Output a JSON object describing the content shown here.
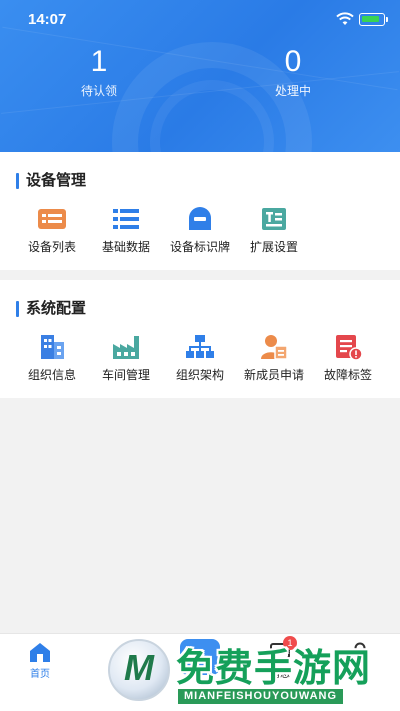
{
  "status_bar": {
    "time": "14:07"
  },
  "stats": [
    {
      "value": "1",
      "label": "待认领"
    },
    {
      "value": "0",
      "label": "处理中"
    }
  ],
  "sections": [
    {
      "title": "设备管理",
      "items": [
        {
          "label": "设备列表",
          "icon": "device-list-icon"
        },
        {
          "label": "基础数据",
          "icon": "list-icon"
        },
        {
          "label": "设备标识牌",
          "icon": "device-tag-icon"
        },
        {
          "label": "扩展设置",
          "icon": "extend-settings-icon"
        }
      ]
    },
    {
      "title": "系统配置",
      "items": [
        {
          "label": "组织信息",
          "icon": "building-icon"
        },
        {
          "label": "车间管理",
          "icon": "factory-icon"
        },
        {
          "label": "组织架构",
          "icon": "org-chart-icon"
        },
        {
          "label": "新成员申请",
          "icon": "new-member-icon"
        },
        {
          "label": "故障标签",
          "icon": "fault-tag-icon"
        }
      ]
    }
  ],
  "tabbar": {
    "home": "首页",
    "messages": "消息",
    "messages_badge": "1"
  },
  "watermark": {
    "title": "免费手游网",
    "subtitle": "MIANFEISHOUYOUWANG",
    "logo_letter": "M"
  },
  "colors": {
    "primary": "#2f7fe8",
    "orange": "#ec8b4a",
    "teal": "#4aa8a0",
    "red": "#e4474c"
  }
}
